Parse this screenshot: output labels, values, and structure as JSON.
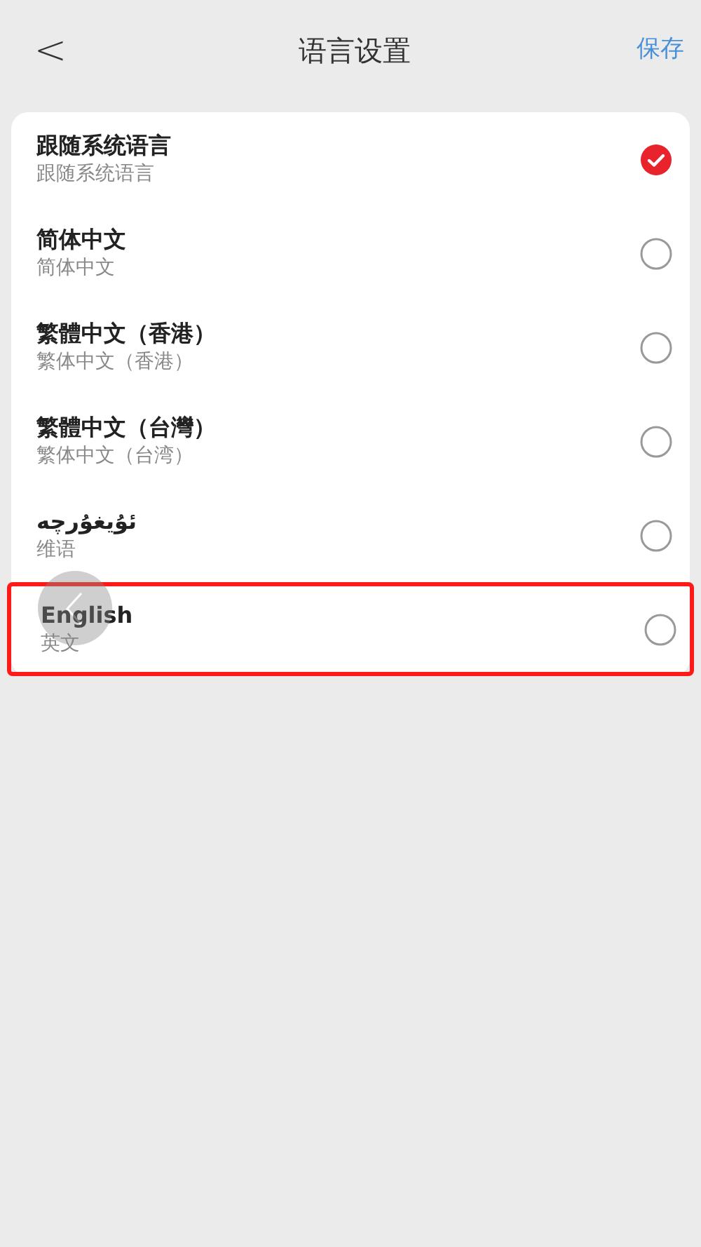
{
  "header": {
    "back": "<",
    "title": "语言设置",
    "action": "保存"
  },
  "languages": [
    {
      "name": "跟随系统语言",
      "subtitle": "跟随系统语言",
      "selected": true,
      "highlighted": false
    },
    {
      "name": "简体中文",
      "subtitle": "简体中文",
      "selected": false,
      "highlighted": false
    },
    {
      "name": "繁體中文（香港）",
      "subtitle": "繁体中文（香港）",
      "selected": false,
      "highlighted": false
    },
    {
      "name": "繁體中文（台灣）",
      "subtitle": "繁体中文（台湾）",
      "selected": false,
      "highlighted": false
    },
    {
      "name": "ئۇيغۇرچە",
      "subtitle": "维语",
      "selected": false,
      "highlighted": false
    },
    {
      "name": "English",
      "subtitle": "英文",
      "selected": false,
      "highlighted": true
    }
  ]
}
